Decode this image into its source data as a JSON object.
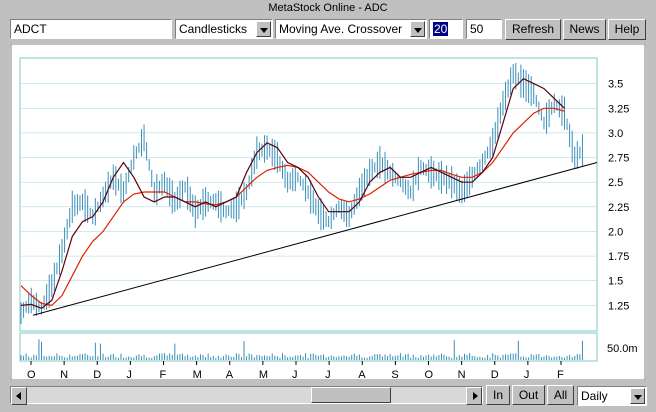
{
  "window": {
    "title": "MetaStock Online - ADC"
  },
  "toolbar": {
    "symbol_value": "ADCT",
    "chart_style": "Candlesticks",
    "indicator": "Moving Ave. Crossover",
    "period_short": "20",
    "period_long": "50",
    "refresh_label": "Refresh",
    "news_label": "News",
    "help_label": "Help"
  },
  "bottom_bar": {
    "zoom_in_label": "In",
    "zoom_out_label": "Out",
    "all_label": "All",
    "interval": "Daily"
  },
  "colors": {
    "price_bars": "#3a8fb8",
    "short_ma": "#5a0010",
    "long_ma": "#e02000",
    "trendline": "#000000",
    "grid": "#9fd6d6",
    "chart_bg": "#ffffff"
  },
  "chart_data": {
    "type": "line",
    "x_tick_labels": [
      "O",
      "N",
      "D",
      "J",
      "F",
      "M",
      "A",
      "M",
      "J",
      "J",
      "A",
      "S",
      "O",
      "N",
      "D",
      "J",
      "F"
    ],
    "y_tick_labels": [
      "3.5",
      "3.25",
      "3.0",
      "2.75",
      "2.5",
      "2.25",
      "2.0",
      "1.75",
      "1.5",
      "1.25"
    ],
    "ylim": [
      1.0,
      3.75
    ],
    "volume_label": "50.0m",
    "grid": true,
    "series": [
      {
        "values": [
          1.17,
          1.3,
          1.22,
          1.45,
          1.8,
          2.25,
          2.3,
          2.15,
          2.35,
          2.55,
          2.4,
          2.75,
          2.95,
          2.4,
          2.5,
          2.3,
          2.45,
          2.2,
          2.3,
          2.3,
          2.2,
          2.25,
          2.4,
          2.8,
          2.85,
          2.75,
          2.5,
          2.55,
          2.4,
          2.2,
          2.1,
          2.25,
          2.15,
          2.4,
          2.6,
          2.7,
          2.6,
          2.5,
          2.4,
          2.65,
          2.6,
          2.55,
          2.5,
          2.4,
          2.55,
          2.7,
          2.9,
          3.3,
          3.6,
          3.5,
          3.4,
          3.1,
          3.3,
          3.2,
          2.75,
          2.85
        ]
      },
      {
        "values": [
          1.25,
          1.26,
          1.22,
          1.3,
          1.6,
          1.95,
          2.1,
          2.15,
          2.3,
          2.55,
          2.7,
          2.55,
          2.35,
          2.3,
          2.35,
          2.35,
          2.3,
          2.25,
          2.3,
          2.25,
          2.3,
          2.35,
          2.6,
          2.8,
          2.9,
          2.85,
          2.7,
          2.65,
          2.55,
          2.35,
          2.2,
          2.2,
          2.2,
          2.3,
          2.5,
          2.6,
          2.65,
          2.55,
          2.55,
          2.6,
          2.65,
          2.6,
          2.55,
          2.5,
          2.5,
          2.6,
          2.75,
          3.1,
          3.45,
          3.55,
          3.5,
          3.45,
          3.35,
          3.25
        ]
      },
      {
        "values": [
          1.45,
          1.35,
          1.27,
          1.25,
          1.35,
          1.55,
          1.75,
          1.9,
          2.0,
          2.15,
          2.3,
          2.38,
          2.4,
          2.4,
          2.4,
          2.35,
          2.3,
          2.3,
          2.28,
          2.27,
          2.3,
          2.35,
          2.45,
          2.55,
          2.62,
          2.65,
          2.67,
          2.65,
          2.6,
          2.5,
          2.4,
          2.33,
          2.3,
          2.33,
          2.38,
          2.45,
          2.52,
          2.55,
          2.58,
          2.6,
          2.62,
          2.62,
          2.58,
          2.55,
          2.55,
          2.6,
          2.7,
          2.85,
          3.0,
          3.1,
          3.2,
          3.25,
          3.25,
          3.22
        ]
      },
      {
        "x": [
          0,
          55
        ],
        "values": [
          1.15,
          2.7
        ]
      }
    ]
  }
}
